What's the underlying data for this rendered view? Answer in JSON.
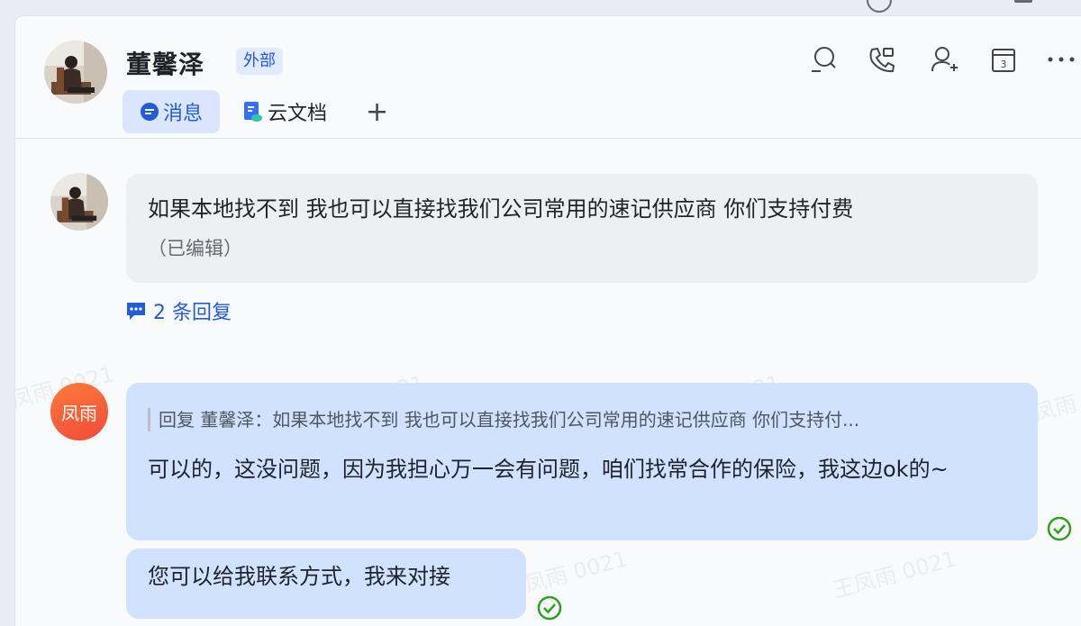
{
  "header": {
    "contact_name": "董馨泽",
    "badge": "外部",
    "tabs": [
      {
        "label": "消息",
        "icon": "chat-bubble-icon"
      },
      {
        "label": "云文档",
        "icon": "cloud-doc-icon"
      }
    ],
    "add_tab_label": "+",
    "tools": [
      "search-icon",
      "phone-icon",
      "add-member-icon",
      "calendar-icon",
      "more-icon"
    ],
    "calendar_day": "3"
  },
  "messages": [
    {
      "sender": "董馨泽",
      "text": "如果本地找不到 我也可以直接找我们公司常用的速记供应商 你们支持付费",
      "edited": "（已编辑）",
      "replies": "2 条回复"
    },
    {
      "sender_avatar_text": "凤雨",
      "quote": "回复 董馨泽：如果本地找不到 我也可以直接找我们公司常用的速记供应商 你们支持付...",
      "text": "可以的，这没问题，因为我担心万一会有问题，咱们找常合作的保险，我这边ok的~"
    },
    {
      "text": "您可以给我联系方式，我来对接"
    }
  ],
  "watermark": "王凤雨 0021",
  "colors": {
    "accent": "#245bdb",
    "own_bubble": "#d0e2ff",
    "other_bubble": "#eeeff2",
    "read_check": "#2ea121"
  }
}
